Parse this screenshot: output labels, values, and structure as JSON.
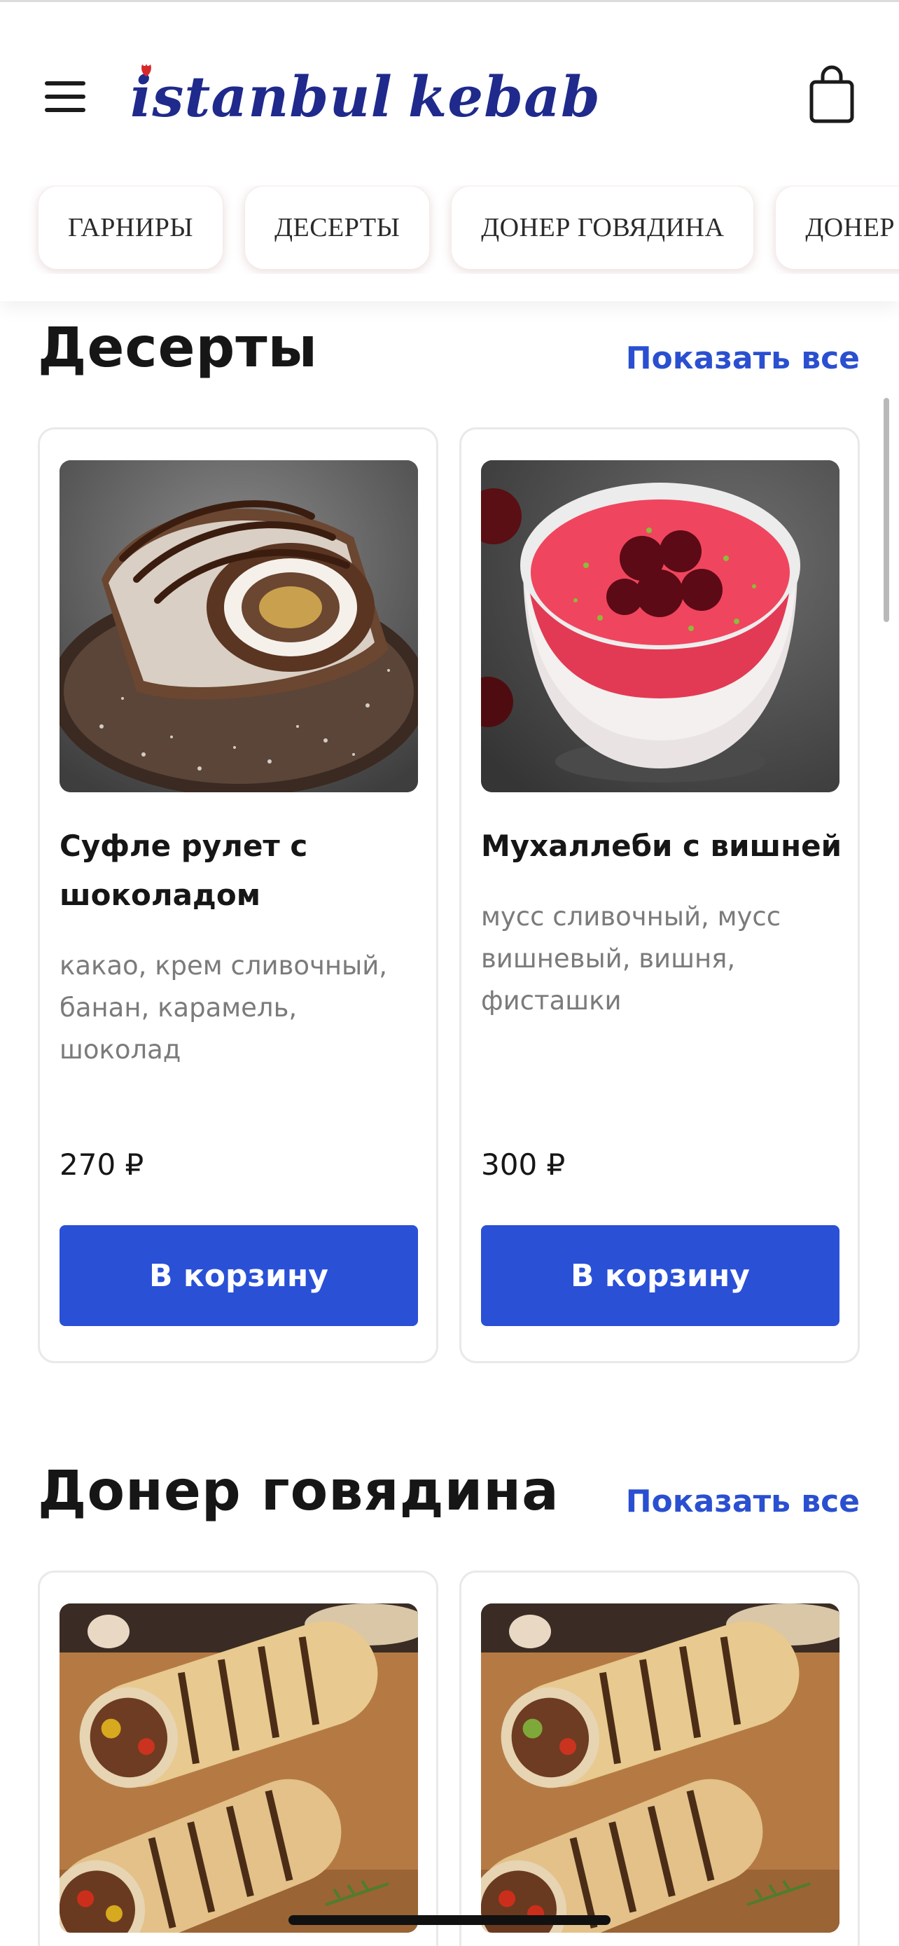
{
  "header": {
    "logo_text_1": "istanbul",
    "logo_text_2": "kebab",
    "logo_color": "#1f2a8c",
    "accent_red": "#d6282c"
  },
  "tabs": [
    {
      "label": "ГАРНИРЫ"
    },
    {
      "label": "ДЕСЕРТЫ"
    },
    {
      "label": "ДОНЕР ГОВЯДИНА"
    },
    {
      "label": "ДОНЕР КУРИЦА"
    }
  ],
  "sections": [
    {
      "title": "Десерты",
      "show_all": "Показать все",
      "cards": [
        {
          "title": "Суфле рулет с шоколадом",
          "description": "какао, крем сливочный, банан, карамель, шоколад",
          "price": "270 ₽",
          "button": "В корзину",
          "image": "chocolate-roll-photo"
        },
        {
          "title": "Мухаллеби с вишней",
          "description": "мусс сливочный, мусс вишневый, вишня, фисташки",
          "price": "300 ₽",
          "button": "В корзину",
          "image": "cherry-muhallebi-photo"
        }
      ]
    },
    {
      "title": "Донер говядина",
      "show_all": "Показать все",
      "cards": [
        {
          "image": "beef-doner-wrap-photo"
        },
        {
          "image": "beef-doner-wrap-photo"
        }
      ]
    }
  ],
  "colors": {
    "button_blue": "#2a50d6",
    "link_blue": "#2a4fd0",
    "text_dark": "#161616",
    "text_muted": "#7b7b7b"
  }
}
